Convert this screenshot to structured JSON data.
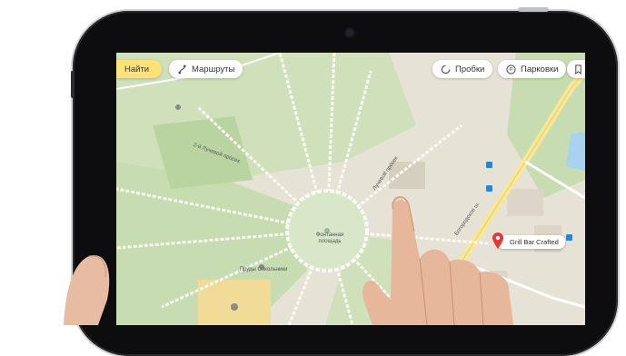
{
  "toolbar": {
    "search_label": "Найти",
    "routes_label": "Маршруты",
    "traffic_label": "Пробки",
    "parking_label": "Парковки"
  },
  "map": {
    "pin_label": "Grill Bar Crafted",
    "place_labels": [
      "Фонтанная площадь",
      "Пруды Сокольники"
    ],
    "street_labels": [
      "2-й Лучевой просек",
      "Лучевой просек",
      "Богородское ш."
    ]
  },
  "colors": {
    "search_bg": "#fde278",
    "pin": "#e53935",
    "park": "#c7dcb0",
    "water": "#a8d2ee"
  },
  "icons": [
    "route-icon",
    "traffic-icon",
    "parking-icon",
    "bookmark-icon",
    "pin-icon",
    "camera-icon"
  ]
}
